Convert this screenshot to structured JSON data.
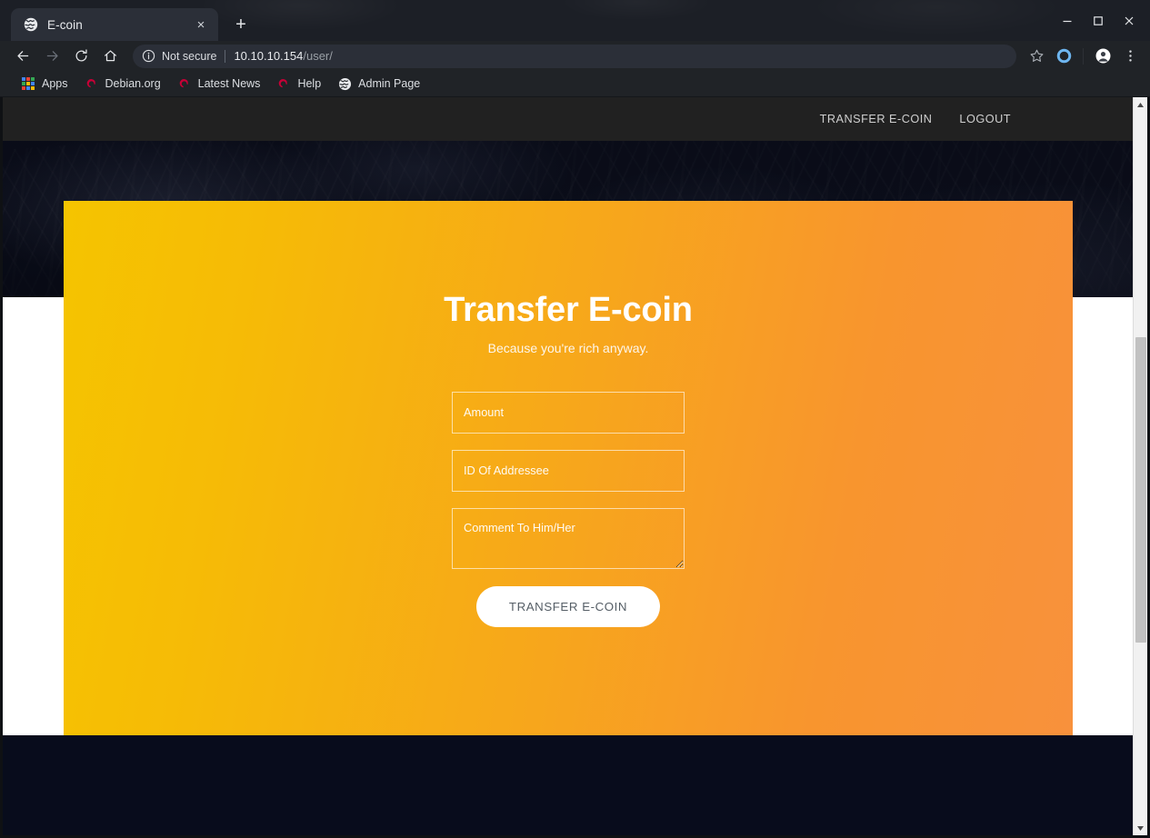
{
  "browser": {
    "tab": {
      "title": "E-coin",
      "favicon": "globe-icon",
      "close_label": "×"
    },
    "new_tab_label": "+",
    "window_controls": {
      "minimize": "minimize-icon",
      "maximize": "maximize-icon",
      "close": "close-icon"
    },
    "toolbar": {
      "back": "back-arrow-icon",
      "forward": "forward-arrow-icon",
      "reload": "reload-icon",
      "home": "home-icon",
      "security_icon": "info-circle-icon",
      "security_text": "Not secure",
      "url_host": "10.10.10.154",
      "url_path": "/user/",
      "url_full": "10.10.10.154/user/",
      "bookmark_star": "star-icon",
      "extension": "extension-circle-icon",
      "profile": "profile-avatar-icon",
      "menu": "three-dot-menu-icon"
    },
    "bookmarks": [
      {
        "label": "Apps",
        "icon": "apps-grid-icon"
      },
      {
        "label": "Debian.org",
        "icon": "debian-swirl-icon"
      },
      {
        "label": "Latest News",
        "icon": "debian-swirl-icon"
      },
      {
        "label": "Help",
        "icon": "debian-swirl-icon"
      },
      {
        "label": "Admin Page",
        "icon": "globe-icon"
      }
    ]
  },
  "page": {
    "nav": {
      "links": [
        {
          "label": "TRANSFER E-COIN"
        },
        {
          "label": "LOGOUT"
        }
      ]
    },
    "card": {
      "title": "Transfer E-coin",
      "subtitle": "Because you're rich anyway.",
      "gradient_start": "#f5c400",
      "gradient_end": "#f8913c",
      "form": {
        "amount": {
          "placeholder": "Amount",
          "value": ""
        },
        "addressee": {
          "placeholder": "ID Of Addressee",
          "value": ""
        },
        "comment": {
          "placeholder": "Comment To Him/Her",
          "value": ""
        },
        "submit_label": "TRANSFER E-COIN"
      }
    },
    "scrollbar": {
      "up_arrow": "scroll-up-arrow-icon",
      "down_arrow": "scroll-down-arrow-icon"
    }
  }
}
